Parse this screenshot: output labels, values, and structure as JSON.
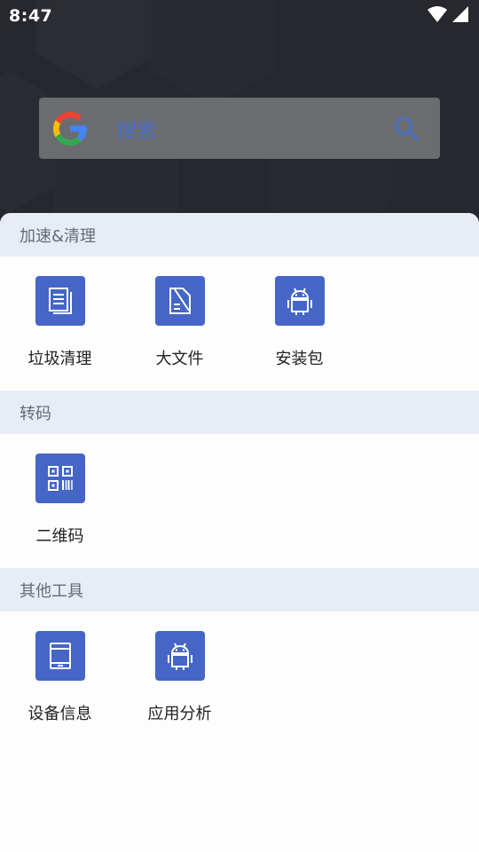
{
  "status_bar": {
    "time": "8:47"
  },
  "search": {
    "placeholder": "搜索"
  },
  "sections": [
    {
      "title": "加速&清理",
      "tools": [
        {
          "label": "垃圾清理",
          "icon": "document-stack-icon"
        },
        {
          "label": "大文件",
          "icon": "file-icon"
        },
        {
          "label": "安装包",
          "icon": "android-icon"
        }
      ]
    },
    {
      "title": "转码",
      "tools": [
        {
          "label": "二维码",
          "icon": "qr-code-icon"
        }
      ]
    },
    {
      "title": "其他工具",
      "tools": [
        {
          "label": "设备信息",
          "icon": "device-icon"
        },
        {
          "label": "应用分析",
          "icon": "android-icon"
        }
      ]
    }
  ],
  "colors": {
    "accent": "#4566c6",
    "section_bg": "#e8ecf4",
    "search_text": "#4a6fc4"
  }
}
